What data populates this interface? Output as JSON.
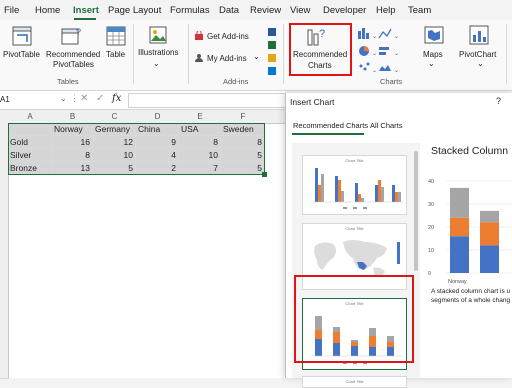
{
  "menu": {
    "items": [
      "File",
      "Home",
      "Insert",
      "Page Layout",
      "Formulas",
      "Data",
      "Review",
      "View",
      "Developer",
      "Help",
      "Team"
    ],
    "active": "Insert"
  },
  "ribbon": {
    "pivottable": "PivotTable",
    "recommended_pivottables_line1": "Recommended",
    "recommended_pivottables_line2": "PivotTables",
    "table": "Table",
    "tables_group": "Tables",
    "illustrations": "Illustrations",
    "get_addins": "Get Add-ins",
    "my_addins": "My Add-ins",
    "addins_group": "Add-ins",
    "recommended_charts_line1": "Recommended",
    "recommended_charts_line2": "Charts",
    "charts_group": "Charts",
    "maps": "Maps",
    "pivotchart": "PivotChart"
  },
  "formula_bar": {
    "name_box": "A1",
    "fx": "fx"
  },
  "grid": {
    "columns": [
      "A",
      "B",
      "C",
      "D",
      "E",
      "F"
    ],
    "header_row": [
      "",
      "Norway",
      "Germany",
      "China",
      "USA",
      "Sweden"
    ],
    "rows": [
      [
        "Gold",
        "16",
        "12",
        "9",
        "8",
        "8"
      ],
      [
        "Silver",
        "8",
        "10",
        "4",
        "10",
        "5"
      ],
      [
        "Bronze",
        "13",
        "5",
        "2",
        "7",
        "5"
      ]
    ]
  },
  "dialog": {
    "title": "Insert Chart",
    "help": "?",
    "tab_recommended": "Recommended Charts",
    "tab_all": "All Charts",
    "thumb_title": "Chart Title",
    "preview_title": "Stacked Column",
    "desc_line1": "A stacked column chart is u",
    "desc_line2": "segments of a whole chang"
  },
  "colors": {
    "excel_green": "#1e6f3c",
    "series_gold": "#4472c4",
    "series_silver": "#ed7d31",
    "series_bronze": "#a5a5a5",
    "highlight_red": "#e01414"
  },
  "chart_data": {
    "type": "bar",
    "stacked": true,
    "title": "Stacked Column",
    "categories": [
      "Norway",
      "Germany",
      "China",
      "USA",
      "Sweden"
    ],
    "series": [
      {
        "name": "Gold",
        "values": [
          16,
          12,
          9,
          8,
          8
        ]
      },
      {
        "name": "Silver",
        "values": [
          8,
          10,
          4,
          10,
          5
        ]
      },
      {
        "name": "Bronze",
        "values": [
          13,
          5,
          2,
          7,
          5
        ]
      }
    ],
    "visible_ticks": [
      "40",
      "30",
      "20",
      "10",
      "0"
    ],
    "visible_categories": [
      "Norway"
    ],
    "ylim": [
      0,
      40
    ],
    "grid": true
  }
}
